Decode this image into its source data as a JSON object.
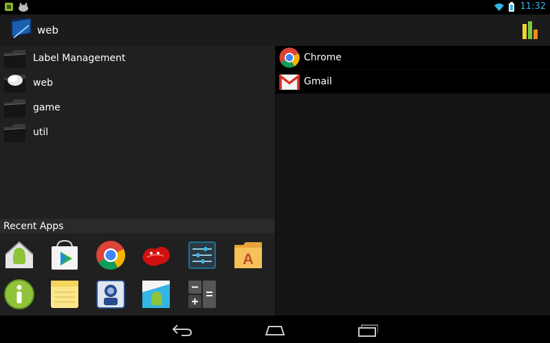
{
  "status_bar": {
    "time": "11:32"
  },
  "action_bar": {
    "title": "web"
  },
  "labels": [
    {
      "label": "Label Management",
      "icon": "folder-icon"
    },
    {
      "label": "web",
      "icon": "web-folder-icon"
    },
    {
      "label": "game",
      "icon": "folder-icon"
    },
    {
      "label": "util",
      "icon": "folder-icon"
    }
  ],
  "apps": [
    {
      "label": "Chrome",
      "icon": "chrome-icon"
    },
    {
      "label": "Gmail",
      "icon": "gmail-icon"
    }
  ],
  "recent": {
    "header": "Recent Apps",
    "items": [
      "home-android-icon",
      "play-store-icon",
      "chrome-icon",
      "jellybean-icon",
      "settings-icon",
      "file-manager-icon",
      "info-icon",
      "notes-icon",
      "camera-app-icon",
      "android-app-icon",
      "calculator-icon"
    ]
  },
  "colors": {
    "accent": "#33b5e5",
    "left_bg": "#202020",
    "right_bg": "#141414"
  }
}
